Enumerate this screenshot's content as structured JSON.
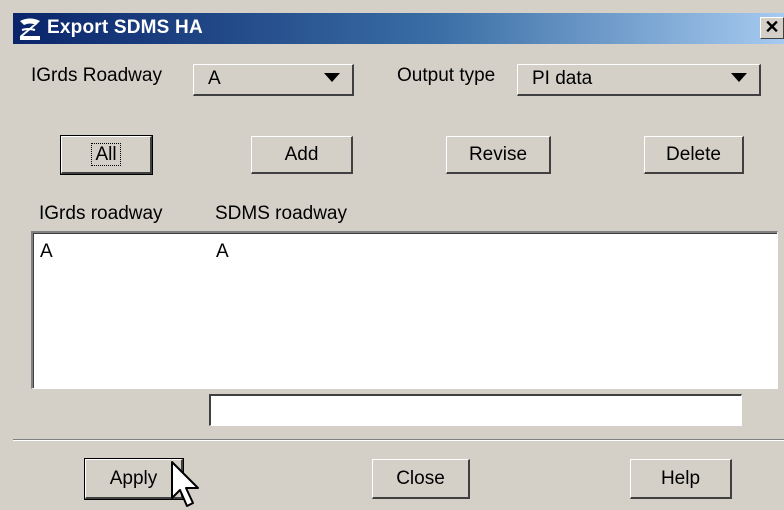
{
  "window": {
    "title": "Export SDMS HA",
    "close_glyph": "✕",
    "icon": "app-logo-icon"
  },
  "controls": {
    "igrds_roadway_label": "IGrds Roadway",
    "igrds_roadway_value": "A",
    "output_type_label": "Output type",
    "output_type_value": "PI data"
  },
  "buttons": {
    "all": "All",
    "add": "Add",
    "revise": "Revise",
    "delete": "Delete"
  },
  "list": {
    "headers": [
      "IGrds roadway",
      "SDMS roadway"
    ],
    "rows": [
      {
        "igrds": "A",
        "sdms": "A"
      }
    ]
  },
  "text_field": {
    "value": ""
  },
  "footer": {
    "apply": "Apply",
    "close": "Close",
    "help": "Help"
  },
  "colors": {
    "title_start": "#0a246a",
    "title_end": "#a6caf0",
    "face": "#d4d0c8"
  }
}
